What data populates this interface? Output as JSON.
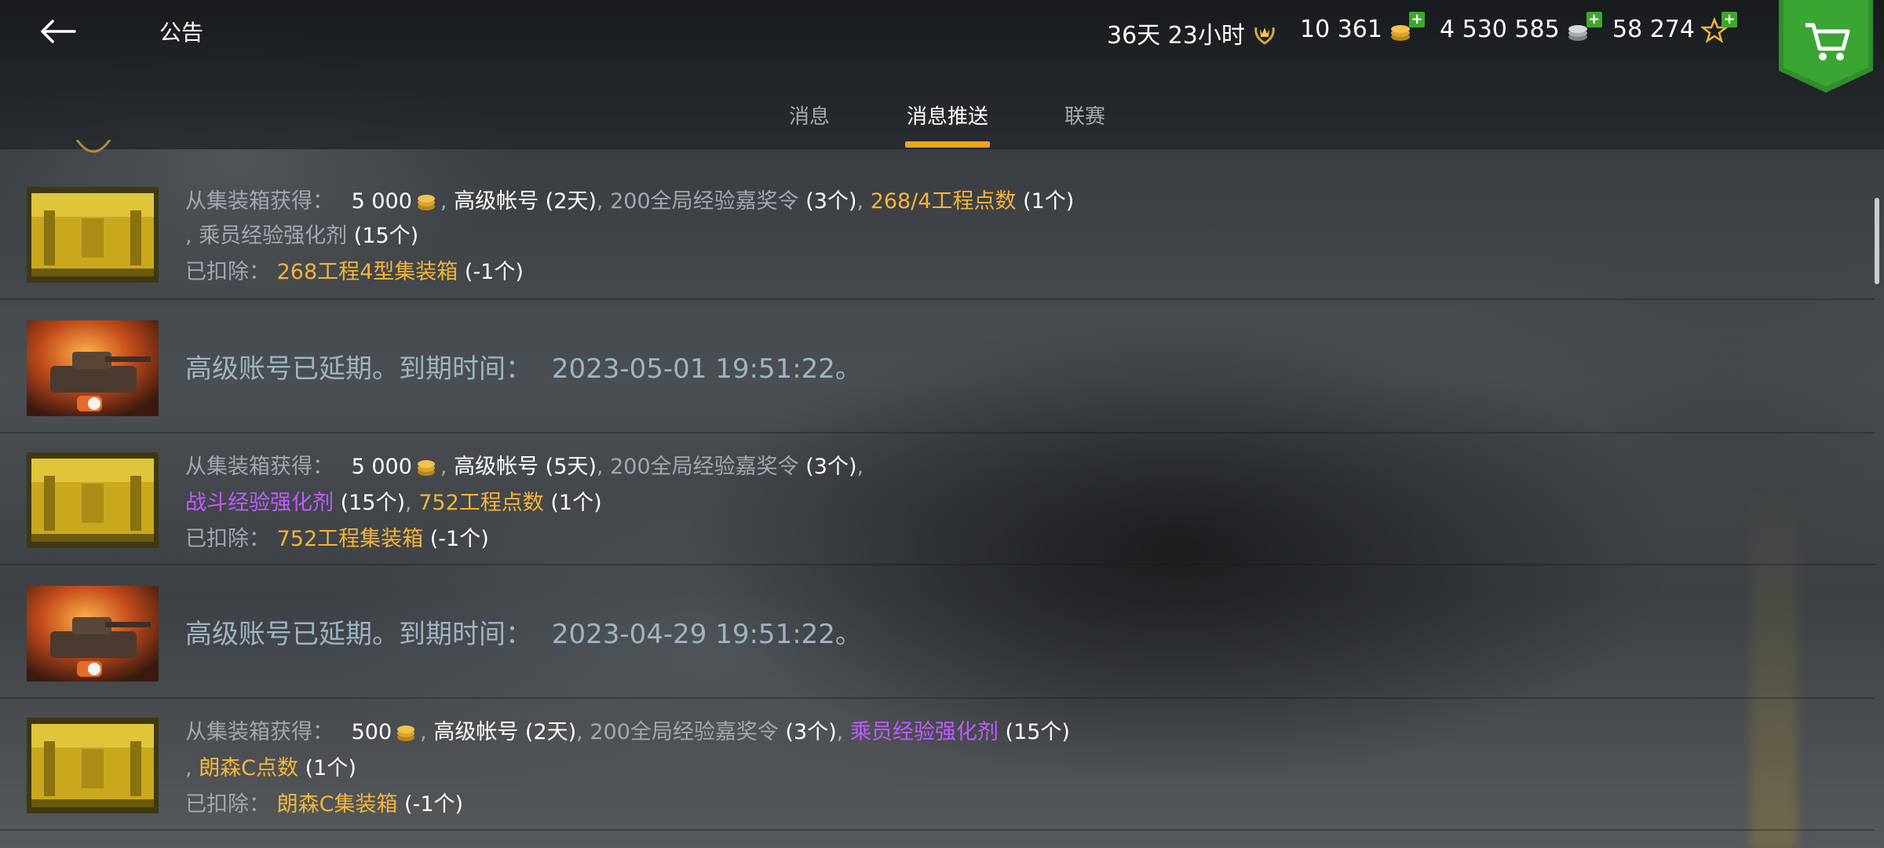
{
  "header": {
    "title": "公告",
    "back_icon": "back-arrow-icon",
    "currencies": [
      {
        "name": "premium",
        "value": "36天 23小时",
        "icon": "laurel-crown-icon"
      },
      {
        "name": "gold",
        "value": "10 361",
        "icon": "gold-coins-icon"
      },
      {
        "name": "silver",
        "value": "4 530 585",
        "icon": "silver-coins-icon"
      },
      {
        "name": "free-xp",
        "value": "58 274",
        "icon": "star-icon"
      }
    ],
    "shop_icon": "shopping-cart-icon"
  },
  "tabs": [
    {
      "label": "消息",
      "active": false
    },
    {
      "label": "消息推送",
      "active": true
    },
    {
      "label": "联赛",
      "active": false
    }
  ],
  "colors": {
    "accent": "#f0a419",
    "gold_text": "#f2b53a",
    "purple_text": "#c05bff",
    "grey_text": "#a2a8ad",
    "plus_green": "#3fa82c"
  },
  "messages": [
    {
      "type": "container",
      "line1": {
        "prefix": "从集装箱获得：",
        "gold_amount": "5 000",
        "sep1": ",",
        "premium": "高级帐号",
        "premium_qty": "(2天)",
        "sep2": ",",
        "booster": "200全局经验嘉奖令",
        "booster_qty": "(3个)",
        "sep3": ",",
        "points": "268/4工程点数",
        "points_qty": "(1个)"
      },
      "line2": {
        "sep": ",",
        "item": "乘员经验强化剂",
        "item_qty": "(15个)"
      },
      "line3": {
        "prefix": "已扣除：",
        "item": "268工程4型集装箱",
        "item_qty": "(-1个)"
      }
    },
    {
      "type": "premium",
      "text_prefix": "高级账号已延期。到期时间：",
      "date": "2023-05-01 19:51:22。"
    },
    {
      "type": "container",
      "line1": {
        "prefix": "从集装箱获得：",
        "gold_amount": "5 000",
        "sep1": ",",
        "premium": "高级帐号",
        "premium_qty": "(5天)",
        "sep2": ",",
        "booster": "200全局经验嘉奖令",
        "booster_qty": "(3个)",
        "sep3": ","
      },
      "line2": {
        "item": "战斗经验强化剂",
        "item_qty": "(15个)",
        "sep": ",",
        "points": "752工程点数",
        "points_qty": "(1个)"
      },
      "line3": {
        "prefix": "已扣除：",
        "item": "752工程集装箱",
        "item_qty": "(-1个)"
      }
    },
    {
      "type": "premium",
      "text_prefix": "高级账号已延期。到期时间：",
      "date": "2023-04-29 19:51:22。"
    },
    {
      "type": "container",
      "line1": {
        "prefix": "从集装箱获得：",
        "gold_amount": "500",
        "sep1": ",",
        "premium": "高级帐号",
        "premium_qty": "(2天)",
        "sep2": ",",
        "booster": "200全局经验嘉奖令",
        "booster_qty": "(3个)",
        "sep3": ",",
        "item": "乘员经验强化剂",
        "item_qty": "(15个)"
      },
      "line2": {
        "sep": ",",
        "points": "朗森C点数",
        "points_qty": "(1个)"
      },
      "line3": {
        "prefix": "已扣除：",
        "item": "朗森C集装箱",
        "item_qty": "(-1个)"
      }
    }
  ]
}
